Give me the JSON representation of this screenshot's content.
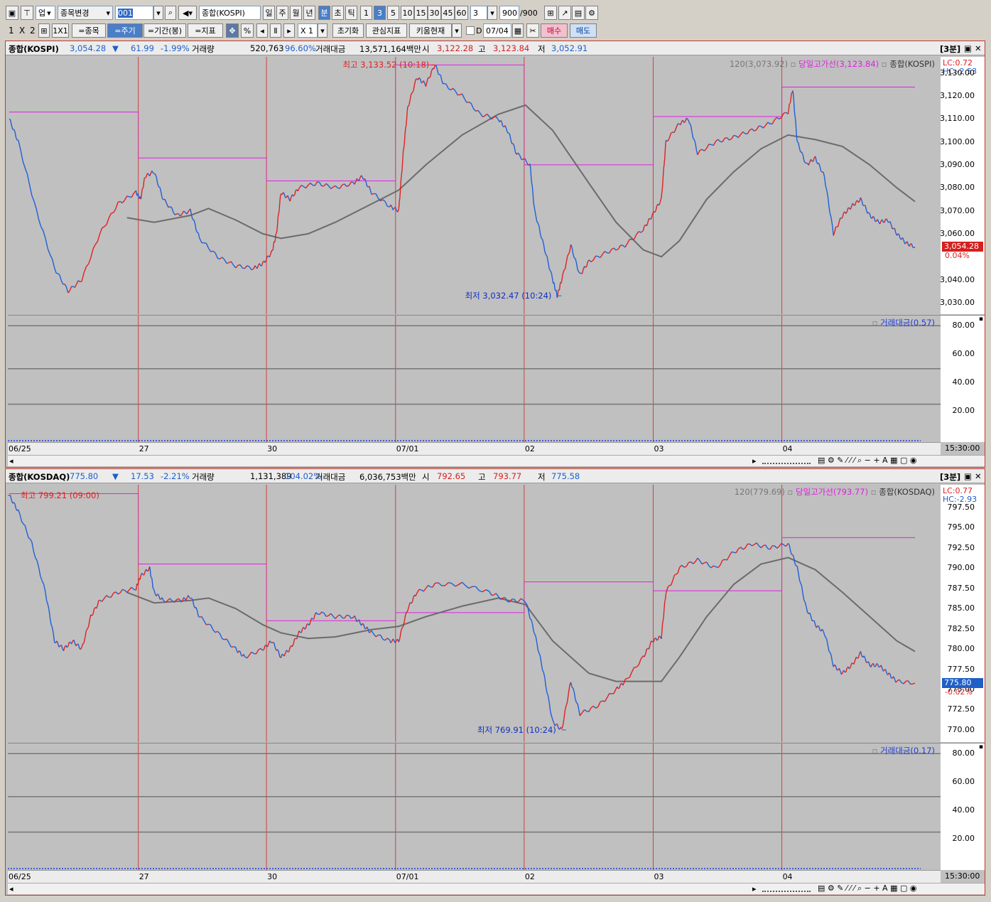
{
  "toolbar1": {
    "market": "업",
    "change_stock": "종목변경",
    "code": "001",
    "index_name": "종합(KOSPI)",
    "periods": [
      "일",
      "주",
      "월",
      "년",
      "분",
      "초",
      "틱"
    ],
    "minutes": [
      "1",
      "3",
      "5",
      "10",
      "15",
      "30",
      "45",
      "60"
    ],
    "selected_period": "분",
    "selected_minute": "3",
    "interval_value": "3",
    "count": "900",
    "count_total": "/900"
  },
  "toolbar2": {
    "layout": [
      "1",
      "X",
      "2"
    ],
    "layout_1x1": "1X1",
    "stock_btn": "=종목",
    "period_btn": "=주기",
    "range_btn": "=기간(봉)",
    "indicator_btn": "=지표",
    "percent": "%",
    "zoom": "X 1",
    "reset": "초기화",
    "watch": "관심지표",
    "kiwoom": "키움현재",
    "d_label": "D",
    "date": "07/04",
    "buy": "매수",
    "sell": "매도"
  },
  "dates": [
    "06/25",
    "27",
    "30",
    "07/01",
    "02",
    "03",
    "04"
  ],
  "panels": [
    {
      "name": "종합(KOSPI)",
      "price": "3,054.28",
      "arrow": "▼",
      "change": "61.99",
      "pct": "-1.99%",
      "vol_label": "거래량",
      "volume": "520,763",
      "vol_pct": "96.60%",
      "amt_label": "거래대금",
      "amount": "13,571,164백만",
      "open_label": "시",
      "open": "3,122.28",
      "high_label": "고",
      "high": "3,123.84",
      "low_label": "저",
      "low": "3,052.91",
      "interval": "[3분]",
      "ma_legend": "120(3,073.92)",
      "hline_legend": "당일고가선(3,123.84)",
      "series_legend": "종합(KOSPI)",
      "lc": "LC:0.72",
      "hc": "HC:-2.53",
      "high_mark": "최고 3,133.52 (10:18)",
      "low_mark": "최저 3,032.47 (10:24)",
      "price_tag": "3,054.28",
      "price_tag_pct": "0.04%",
      "ticks": [
        "3,130.00",
        "3,120.00",
        "3,110.00",
        "3,100.00",
        "3,090.00",
        "3,080.00",
        "3,070.00",
        "3,060.00",
        "3,040.00",
        "3,030.00"
      ],
      "ticks_pos": [
        3130,
        3120,
        3110,
        3100,
        3090,
        3080,
        3070,
        3060,
        3040,
        3030
      ],
      "ymin": 3025,
      "ymax": 3137,
      "sub_legend": "거래대금(0.57)",
      "sub_ticks": [
        "80.00",
        "60.00",
        "40.00",
        "20.00"
      ],
      "time_label": "15:30:00",
      "tag_color": "#d42020",
      "chart_data": {
        "type": "line",
        "day_high_levels": [
          3113,
          3093,
          3083,
          3133.5,
          3090,
          3111,
          3123.84
        ],
        "close_points": [
          [
            0,
            3110
          ],
          [
            0.01,
            3100
          ],
          [
            0.03,
            3070
          ],
          [
            0.05,
            3045
          ],
          [
            0.065,
            3035
          ],
          [
            0.08,
            3040
          ],
          [
            0.1,
            3060
          ],
          [
            0.12,
            3073
          ],
          [
            0.14,
            3078
          ],
          [
            0.145,
            3075
          ],
          [
            0.15,
            3085
          ],
          [
            0.16,
            3087
          ],
          [
            0.17,
            3075
          ],
          [
            0.185,
            3068
          ],
          [
            0.2,
            3070
          ],
          [
            0.21,
            3058
          ],
          [
            0.23,
            3050
          ],
          [
            0.25,
            3046
          ],
          [
            0.27,
            3045
          ],
          [
            0.28,
            3047
          ],
          [
            0.29,
            3052
          ],
          [
            0.295,
            3060
          ],
          [
            0.3,
            3078
          ],
          [
            0.31,
            3075
          ],
          [
            0.32,
            3080
          ],
          [
            0.34,
            3082
          ],
          [
            0.36,
            3080
          ],
          [
            0.38,
            3082
          ],
          [
            0.39,
            3085
          ],
          [
            0.4,
            3078
          ],
          [
            0.42,
            3072
          ],
          [
            0.43,
            3070
          ],
          [
            0.435,
            3095
          ],
          [
            0.44,
            3115
          ],
          [
            0.45,
            3128
          ],
          [
            0.46,
            3125
          ],
          [
            0.47,
            3133.5
          ],
          [
            0.48,
            3125
          ],
          [
            0.5,
            3120
          ],
          [
            0.52,
            3112
          ],
          [
            0.54,
            3110
          ],
          [
            0.55,
            3105
          ],
          [
            0.56,
            3095
          ],
          [
            0.575,
            3090
          ],
          [
            0.58,
            3070
          ],
          [
            0.59,
            3055
          ],
          [
            0.6,
            3040
          ],
          [
            0.605,
            3033
          ],
          [
            0.61,
            3040
          ],
          [
            0.62,
            3055
          ],
          [
            0.63,
            3042
          ],
          [
            0.64,
            3048
          ],
          [
            0.66,
            3052
          ],
          [
            0.68,
            3055
          ],
          [
            0.7,
            3062
          ],
          [
            0.71,
            3068
          ],
          [
            0.72,
            3075
          ],
          [
            0.725,
            3100
          ],
          [
            0.74,
            3108
          ],
          [
            0.75,
            3110
          ],
          [
            0.76,
            3095
          ],
          [
            0.78,
            3100
          ],
          [
            0.8,
            3102
          ],
          [
            0.82,
            3105
          ],
          [
            0.84,
            3108
          ],
          [
            0.86,
            3113
          ],
          [
            0.865,
            3123
          ],
          [
            0.87,
            3100
          ],
          [
            0.88,
            3090
          ],
          [
            0.89,
            3093
          ],
          [
            0.9,
            3085
          ],
          [
            0.91,
            3060
          ],
          [
            0.92,
            3068
          ],
          [
            0.93,
            3072
          ],
          [
            0.94,
            3075
          ],
          [
            0.95,
            3068
          ],
          [
            0.96,
            3065
          ],
          [
            0.97,
            3066
          ],
          [
            0.98,
            3060
          ],
          [
            0.99,
            3056
          ],
          [
            1.0,
            3054.28
          ]
        ],
        "ma_points": [
          [
            0.13,
            3067
          ],
          [
            0.16,
            3065
          ],
          [
            0.2,
            3068
          ],
          [
            0.22,
            3071
          ],
          [
            0.25,
            3066
          ],
          [
            0.28,
            3060
          ],
          [
            0.3,
            3058
          ],
          [
            0.33,
            3060
          ],
          [
            0.36,
            3065
          ],
          [
            0.4,
            3073
          ],
          [
            0.43,
            3079
          ],
          [
            0.46,
            3090
          ],
          [
            0.5,
            3103
          ],
          [
            0.54,
            3112
          ],
          [
            0.57,
            3116
          ],
          [
            0.6,
            3105
          ],
          [
            0.64,
            3082
          ],
          [
            0.67,
            3065
          ],
          [
            0.7,
            3053
          ],
          [
            0.72,
            3050
          ],
          [
            0.74,
            3057
          ],
          [
            0.77,
            3075
          ],
          [
            0.8,
            3087
          ],
          [
            0.83,
            3097
          ],
          [
            0.86,
            3103
          ],
          [
            0.89,
            3101
          ],
          [
            0.92,
            3098
          ],
          [
            0.95,
            3090
          ],
          [
            0.98,
            3080
          ],
          [
            1.0,
            3074
          ]
        ]
      }
    },
    {
      "name": "종합(KOSDAQ)",
      "price": "775.80",
      "arrow": "▼",
      "change": "17.53",
      "pct": "-2.21%",
      "vol_label": "거래량",
      "volume": "1,131,389",
      "vol_pct": "104.02%",
      "amt_label": "거래대금",
      "amount": "6,036,753백만",
      "open_label": "시",
      "open": "792.65",
      "high_label": "고",
      "high": "793.77",
      "low_label": "저",
      "low": "775.58",
      "interval": "[3분]",
      "ma_legend": "120(779.69)",
      "hline_legend": "당일고가선(793.77)",
      "series_legend": "종합(KOSDAQ)",
      "lc": "LC:0.77",
      "hc": "HC:-2.93",
      "high_mark": "최고 799.21 (09:00)",
      "low_mark": "최저 769.91 (10:24)",
      "price_tag": "775.80",
      "price_tag_pct": "-0.02%",
      "ticks": [
        "797.50",
        "795.00",
        "792.50",
        "790.00",
        "787.50",
        "785.00",
        "782.50",
        "780.00",
        "777.50",
        "775.00",
        "772.50",
        "770.00"
      ],
      "ticks_pos": [
        797.5,
        795,
        792.5,
        790,
        787.5,
        785,
        782.5,
        780,
        777.5,
        775,
        772.5,
        770
      ],
      "ymin": 768.5,
      "ymax": 800.3,
      "sub_legend": "거래대금(0.17)",
      "sub_ticks": [
        "80.00",
        "60.00",
        "40.00",
        "20.00"
      ],
      "time_label": "15:30:00",
      "tag_color": "#1e5fc8",
      "chart_data": {
        "type": "line",
        "day_high_levels": [
          799.2,
          790.5,
          783.5,
          784.5,
          788.3,
          787.2,
          793.77
        ],
        "close_points": [
          [
            0,
            799
          ],
          [
            0.01,
            797
          ],
          [
            0.025,
            793
          ],
          [
            0.04,
            787
          ],
          [
            0.05,
            781
          ],
          [
            0.06,
            780
          ],
          [
            0.07,
            781
          ],
          [
            0.08,
            780
          ],
          [
            0.09,
            784
          ],
          [
            0.1,
            786
          ],
          [
            0.12,
            787
          ],
          [
            0.14,
            787.5
          ],
          [
            0.145,
            789
          ],
          [
            0.155,
            790
          ],
          [
            0.16,
            787
          ],
          [
            0.17,
            786
          ],
          [
            0.19,
            786
          ],
          [
            0.2,
            786.5
          ],
          [
            0.21,
            784
          ],
          [
            0.23,
            782
          ],
          [
            0.25,
            780
          ],
          [
            0.26,
            779
          ],
          [
            0.28,
            780
          ],
          [
            0.29,
            781
          ],
          [
            0.3,
            779
          ],
          [
            0.31,
            780
          ],
          [
            0.32,
            782
          ],
          [
            0.33,
            783
          ],
          [
            0.34,
            784.5
          ],
          [
            0.36,
            784
          ],
          [
            0.38,
            784
          ],
          [
            0.39,
            783
          ],
          [
            0.4,
            782
          ],
          [
            0.42,
            781
          ],
          [
            0.43,
            781
          ],
          [
            0.44,
            785
          ],
          [
            0.45,
            787
          ],
          [
            0.47,
            788
          ],
          [
            0.5,
            788
          ],
          [
            0.53,
            787
          ],
          [
            0.55,
            786
          ],
          [
            0.57,
            786
          ],
          [
            0.58,
            782
          ],
          [
            0.59,
            777
          ],
          [
            0.6,
            771
          ],
          [
            0.61,
            770
          ],
          [
            0.62,
            776
          ],
          [
            0.63,
            772
          ],
          [
            0.65,
            773
          ],
          [
            0.67,
            775
          ],
          [
            0.68,
            776
          ],
          [
            0.7,
            779
          ],
          [
            0.71,
            781
          ],
          [
            0.72,
            781.5
          ],
          [
            0.725,
            787
          ],
          [
            0.74,
            790
          ],
          [
            0.76,
            791
          ],
          [
            0.78,
            790
          ],
          [
            0.8,
            792
          ],
          [
            0.82,
            793
          ],
          [
            0.84,
            792.5
          ],
          [
            0.86,
            793
          ],
          [
            0.87,
            790
          ],
          [
            0.88,
            785
          ],
          [
            0.89,
            783
          ],
          [
            0.9,
            782
          ],
          [
            0.91,
            778
          ],
          [
            0.92,
            777
          ],
          [
            0.93,
            778
          ],
          [
            0.94,
            779.5
          ],
          [
            0.95,
            778
          ],
          [
            0.96,
            778
          ],
          [
            0.97,
            777
          ],
          [
            0.98,
            776
          ],
          [
            1.0,
            775.8
          ]
        ],
        "ma_points": [
          [
            0.13,
            787
          ],
          [
            0.16,
            785.7
          ],
          [
            0.2,
            786
          ],
          [
            0.22,
            786.3
          ],
          [
            0.25,
            785
          ],
          [
            0.28,
            783
          ],
          [
            0.3,
            782
          ],
          [
            0.33,
            781.3
          ],
          [
            0.36,
            781.5
          ],
          [
            0.4,
            782.4
          ],
          [
            0.43,
            782.8
          ],
          [
            0.46,
            784
          ],
          [
            0.5,
            785.3
          ],
          [
            0.54,
            786.3
          ],
          [
            0.57,
            785.5
          ],
          [
            0.6,
            781
          ],
          [
            0.64,
            777
          ],
          [
            0.67,
            776
          ],
          [
            0.7,
            776
          ],
          [
            0.72,
            776
          ],
          [
            0.74,
            779
          ],
          [
            0.77,
            784
          ],
          [
            0.8,
            788
          ],
          [
            0.83,
            790.5
          ],
          [
            0.86,
            791.3
          ],
          [
            0.89,
            789.8
          ],
          [
            0.92,
            787
          ],
          [
            0.95,
            784
          ],
          [
            0.98,
            781
          ],
          [
            1.0,
            779.7
          ]
        ]
      }
    }
  ]
}
